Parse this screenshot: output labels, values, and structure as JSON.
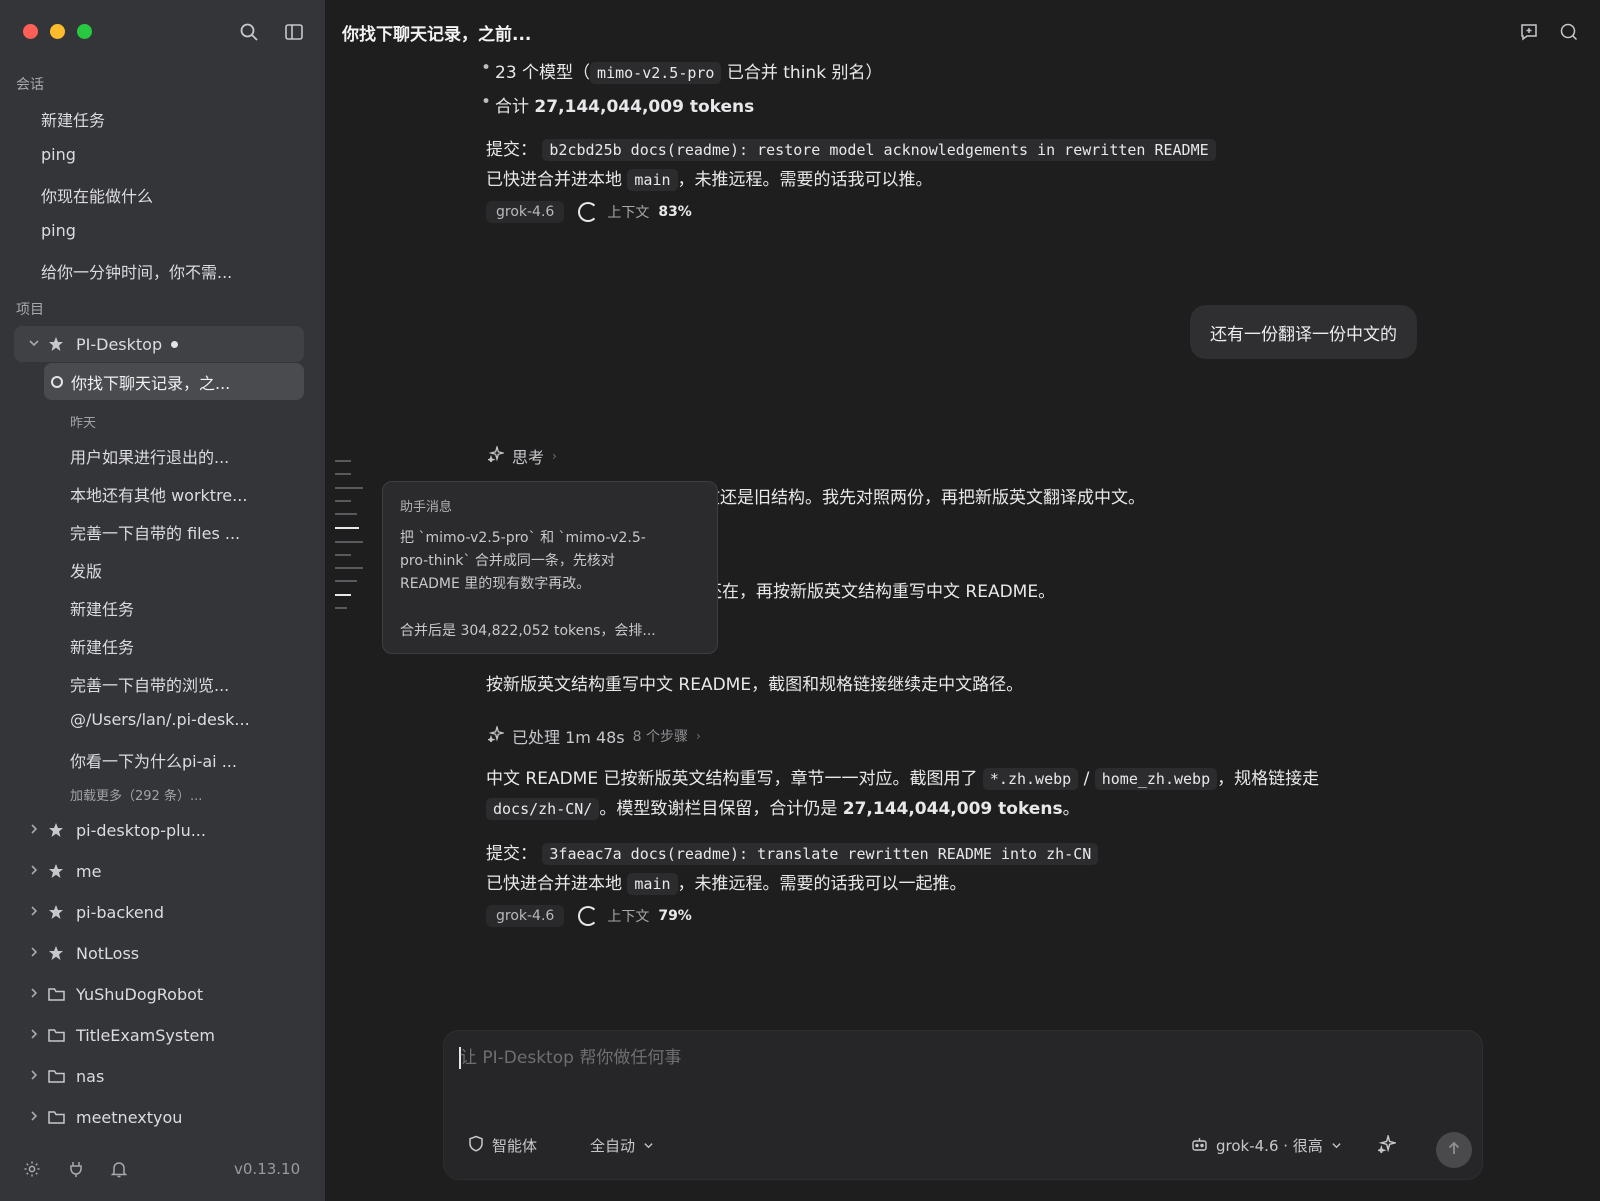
{
  "window": {
    "title": "你找下聊天记录，之前...",
    "version": "v0.13.10"
  },
  "sidebar": {
    "sessions_label": "会话",
    "sessions": [
      "新建任务",
      "ping",
      "你现在能做什么",
      "ping",
      "给你一分钟时间，你不需..."
    ],
    "projects_label": "项目",
    "active_project": {
      "name": "PI-Desktop",
      "active_session": "你找下聊天记录，之...",
      "group_label": "昨天",
      "sessions": [
        "用户如果进行退出的...",
        "本地还有其他 worktre...",
        "完善一下自带的 files ...",
        "发版",
        "新建任务",
        "新建任务",
        "完善一下自带的浏览...",
        "@/Users/lan/.pi-desk...",
        "你看一下为什么pi-ai ..."
      ],
      "load_more": "加载更多（292 条）..."
    },
    "projects": [
      {
        "name": "pi-desktop-plu...",
        "icon": "star-icon"
      },
      {
        "name": "me",
        "icon": "star-icon"
      },
      {
        "name": "pi-backend",
        "icon": "star-icon"
      },
      {
        "name": "NotLoss",
        "icon": "star-icon"
      },
      {
        "name": "YuShuDogRobot",
        "icon": "folder-icon"
      },
      {
        "name": "TitleExamSystem",
        "icon": "folder-icon"
      },
      {
        "name": "nas",
        "icon": "folder-icon"
      },
      {
        "name": "meetnextyou",
        "icon": "folder-icon"
      }
    ]
  },
  "chat": {
    "msg1": {
      "bullet1_pre": "23 个模型（",
      "bullet1_code": "mimo-v2.5-pro",
      "bullet1_post": " 已合并 think 别名）",
      "bullet2_pre": "合计 ",
      "bullet2_bold": "27,144,044,009 tokens",
      "commit_label": "提交：",
      "commit_code": "b2cbd25b docs(readme): restore model acknowledgements in rewritten README",
      "merge_pre": "已快进合并进本地 ",
      "merge_code": "main",
      "merge_post": "，未推远程。需要的话我可以推。",
      "model_chip": "grok-4.6",
      "ctx_label": "上下文",
      "ctx_value": "83%"
    },
    "user_bubble": "还有一份翻译一份中文的",
    "think_label": "思考",
    "msg2_line1": "文还是旧结构。我先对照两份，再把新版英文翻译成中文。",
    "msg2_line2": "还在，再按新版英文结构重写中文 README。",
    "msg2_line3": "按新版英文结构重写中文 README，截图和规格链接继续走中文路径。",
    "processed": {
      "label": "已处理 1m 48s",
      "steps": "8 个步骤"
    },
    "msg3": {
      "p1_pre": "中文 README 已按新版英文结构重写，章节一一对应。截图用了 ",
      "p1_code1": "*.zh.webp",
      "p1_sep": " / ",
      "p1_code2": "home_zh.webp",
      "p1_post": "，规格链接走",
      "p2_code": "docs/zh-CN/",
      "p2_post": "。模型致谢栏目保留，合计仍是 ",
      "p2_bold": "27,144,044,009 tokens",
      "p2_end": "。",
      "commit_label": "提交：",
      "commit_code": "3faeac7a docs(readme): translate rewritten README into zh-CN",
      "merge_pre": "已快进合并进本地 ",
      "merge_code": "main",
      "merge_post": "，未推远程。需要的话我可以一起推。",
      "model_chip": "grok-4.6",
      "ctx_label": "上下文",
      "ctx_value": "79%"
    }
  },
  "tooltip": {
    "heading": "助手消息",
    "body": "把 `mimo-v2.5-pro` 和 `mimo-v2.5-\npro-think` 合并成同一条，先核对\nREADME 里的现有数字再改。",
    "footer": "合并后是 304,822,052 tokens，会排..."
  },
  "composer": {
    "placeholder": "让 PI-Desktop 帮你做任何事",
    "agent_label": "智能体",
    "mode_label": "全自动",
    "model_label": "grok-4.6 · 很高"
  }
}
